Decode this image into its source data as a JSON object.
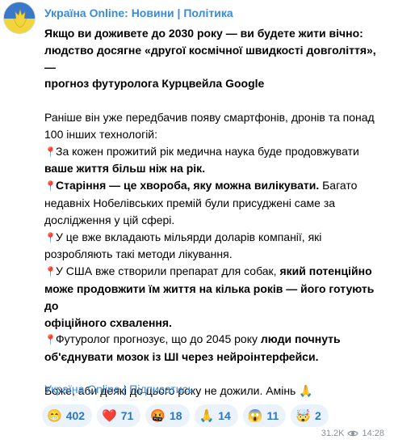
{
  "post": {
    "channel_name": "Україна Online: Новини | Політика",
    "headline_l1": "Якщо ви доживете до 2030 року — ви будете жити вічно:",
    "headline_l2": "людство досягне «другої космічної швидкості довголіття», —",
    "headline_l3": "прогноз футуролога Курцвейла Google",
    "intro_l1": "Раніше він уже передбачив появу смартфонів, дронів та понад",
    "intro_l2": "100 інших технологій:",
    "p1_l1": "За кожен прожитий рік медична наука буде продовжувати",
    "p1_l2": "ваше життя більш ніж на рік.",
    "p2_bold": "Старіння — це хвороба, яку можна вилікувати.",
    "p2_rest": " Багато",
    "p2_l2": "недавніх Нобелівських премій були присуджені саме за",
    "p2_l3": "дослідження у цій сфері.",
    "p3_l1": "У це вже вкладають мільярди доларів компанії, які",
    "p3_l2": "розробляють такі методи лікування.",
    "p4_l1_plain": "У США вже створили препарат для собак, ",
    "p4_l1_bold": "який потенційно",
    "p4_l2": "може продовжити їм життя на кілька років — його готують до",
    "p4_l3": "офіційного схвалення.",
    "p5_l1_plain": "Футуролог прогнозує, що до 2045 року ",
    "p5_l1_bold": "люди почнуть",
    "p5_l2": "об'єднувати мозок із ШІ через нейроінтерфейси.",
    "closing": "Боже, аби деякі до цього року не дожили. Амінь 🙏",
    "footer_channel": "Україна Online",
    "footer_sep": " | ",
    "footer_subscribe": "Підписатись"
  },
  "reactions": [
    {
      "emoji": "😁",
      "count": "402"
    },
    {
      "emoji": "❤️",
      "count": "71"
    },
    {
      "emoji": "🤬",
      "count": "18"
    },
    {
      "emoji": "🙏",
      "count": "14"
    },
    {
      "emoji": "😱",
      "count": "11"
    },
    {
      "emoji": "🤯",
      "count": "2"
    }
  ],
  "meta": {
    "views": "31.2K",
    "time": "14:28"
  },
  "icons": {
    "pin": "round-pushpin-icon",
    "views": "eye-icon"
  }
}
